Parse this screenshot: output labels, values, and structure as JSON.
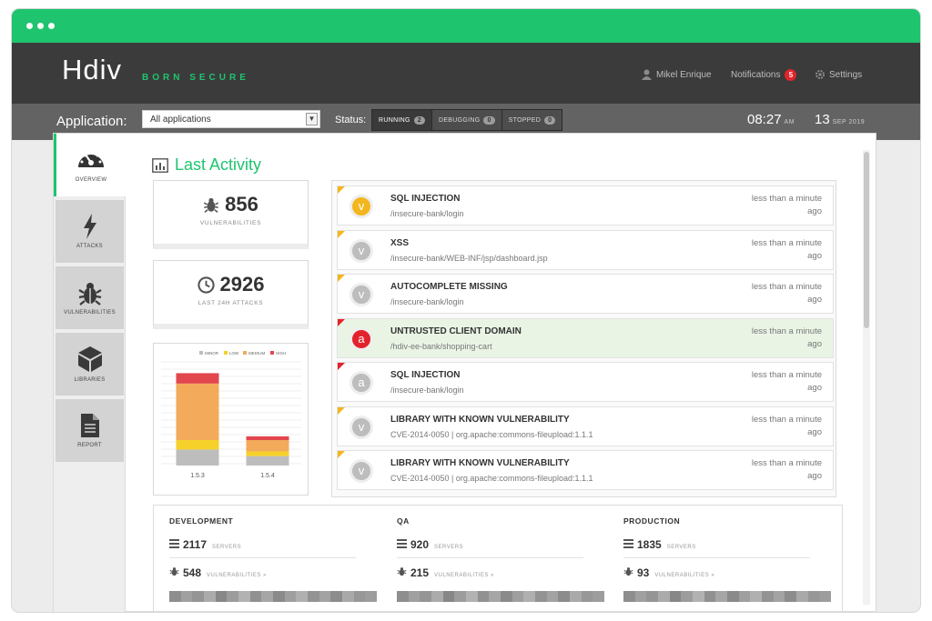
{
  "window": {
    "controls": [
      "close",
      "minimize",
      "maximize"
    ]
  },
  "header": {
    "logo": "Hdiv",
    "tagline": "BORN SECURE",
    "user": {
      "name": "Mikel Enrique",
      "icon": "user-icon"
    },
    "notifications": {
      "label": "Notifications",
      "count": "5"
    },
    "settings": {
      "label": "Settings",
      "icon": "gear-icon"
    }
  },
  "filters": {
    "application_label": "Application:",
    "application_value": "All applications",
    "status_label": "Status:",
    "statuses": [
      {
        "label": "RUNNING",
        "count": "2",
        "active": true
      },
      {
        "label": "DEBUGGING",
        "count": "0",
        "active": false
      },
      {
        "label": "STOPPED",
        "count": "0",
        "active": false
      }
    ],
    "time": "08:27",
    "time_suffix": "AM",
    "day": "13",
    "month_year": "SEP 2019"
  },
  "sidebar": {
    "items": [
      {
        "label": "OVERVIEW",
        "icon": "speedometer-icon",
        "active": true
      },
      {
        "label": "ATTACKS",
        "icon": "lightning-icon",
        "active": false
      },
      {
        "label": "VULNERABILITIES",
        "icon": "bug-icon",
        "active": false
      },
      {
        "label": "LIBRARIES",
        "icon": "cube-icon",
        "active": false
      },
      {
        "label": "REPORT",
        "icon": "document-icon",
        "active": false
      }
    ]
  },
  "main": {
    "title": "Last Activity",
    "title_icon": "bar-chart-icon",
    "stats": [
      {
        "value": "856",
        "label": "VULNERABILITIES",
        "icon": "bug-icon"
      },
      {
        "value": "2926",
        "label": "LAST 24H ATTACKS",
        "icon": "clock-icon"
      }
    ]
  },
  "colors": {
    "accent": "#1fc46f",
    "minor": "#bdbdbd",
    "low": "#f6d12a",
    "medium": "#f3aa5a",
    "high": "#e2474e",
    "danger": "#e3232b"
  },
  "chart_data": {
    "type": "bar",
    "stacked": true,
    "categories": [
      "1.5.3",
      "1.5.4"
    ],
    "series": [
      {
        "name": "MINOR",
        "values": [
          17,
          10
        ]
      },
      {
        "name": "LOW",
        "values": [
          10,
          5
        ]
      },
      {
        "name": "MEDIUM",
        "values": [
          60,
          12
        ]
      },
      {
        "name": "HIGH",
        "values": [
          11,
          4
        ]
      }
    ],
    "ylim": [
      0,
      110
    ],
    "legend": "top-right",
    "grid": true
  },
  "activity": {
    "items": [
      {
        "badge": "v",
        "title": "SQL INJECTION",
        "path": "/insecure-bank/login",
        "time": "less than a minute ago",
        "circle": "#f3b61f",
        "flag": "yellow",
        "highlight": false
      },
      {
        "badge": "v",
        "title": "XSS",
        "path": "/insecure-bank/WEB-INF/jsp/dashboard.jsp",
        "time": "less than a minute ago",
        "circle": "#bdbdbd",
        "flag": "yellow",
        "highlight": false
      },
      {
        "badge": "v",
        "title": "AUTOCOMPLETE MISSING",
        "path": "/insecure-bank/login",
        "time": "less than a minute ago",
        "circle": "#bdbdbd",
        "flag": "yellow",
        "highlight": false
      },
      {
        "badge": "a",
        "title": "UNTRUSTED CLIENT DOMAIN",
        "path": "/hdiv-ee-bank/shopping-cart",
        "time": "less than a minute ago",
        "circle": "#e3232b",
        "flag": "red",
        "highlight": true
      },
      {
        "badge": "a",
        "title": "SQL INJECTION",
        "path": "/insecure-bank/login",
        "time": "less than a minute ago",
        "circle": "#bdbdbd",
        "flag": "red",
        "highlight": false
      },
      {
        "badge": "v",
        "title": "LIBRARY WITH KNOWN VULNERABILITY",
        "path": "CVE-2014-0050 | org.apache:commons-fileupload:1.1.1",
        "time": "less than a minute ago",
        "circle": "#bdbdbd",
        "flag": "yellow",
        "highlight": false
      },
      {
        "badge": "v",
        "title": "LIBRARY WITH KNOWN VULNERABILITY",
        "path": "CVE-2014-0050 | org.apache:commons-fileupload:1.1.1",
        "time": "less than a minute ago",
        "circle": "#bdbdbd",
        "flag": "yellow",
        "highlight": false
      }
    ]
  },
  "environments": [
    {
      "name": "DEVELOPMENT",
      "servers": "2117",
      "servers_label": "SERVERS",
      "vulns": "548",
      "vulns_label": "VULNERABILITIES »"
    },
    {
      "name": "QA",
      "servers": "920",
      "servers_label": "SERVERS",
      "vulns": "215",
      "vulns_label": "VULNERABILITIES »"
    },
    {
      "name": "PRODUCTION",
      "servers": "1835",
      "servers_label": "SERVERS",
      "vulns": "93",
      "vulns_label": "VULNERABILITIES »"
    }
  ]
}
